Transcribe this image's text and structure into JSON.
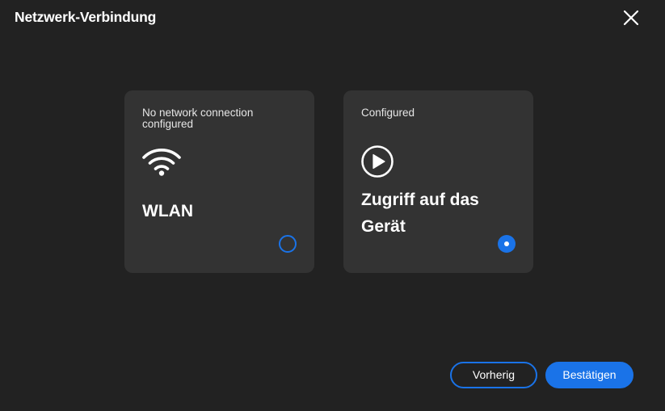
{
  "dialog": {
    "title": "Netzwerk-Verbindung",
    "close_icon": "close-icon"
  },
  "options": [
    {
      "status": "No network connection configured",
      "icon": "wifi-icon",
      "title": "WLAN",
      "selected": false
    },
    {
      "status": "Configured",
      "icon": "play-circle-icon",
      "title": "Zugriff auf das Gerät",
      "selected": true
    }
  ],
  "footer": {
    "previous_label": "Vorherig",
    "confirm_label": "Bestätigen"
  },
  "colors": {
    "background": "#222222",
    "card": "#333333",
    "accent": "#1a73e8"
  }
}
